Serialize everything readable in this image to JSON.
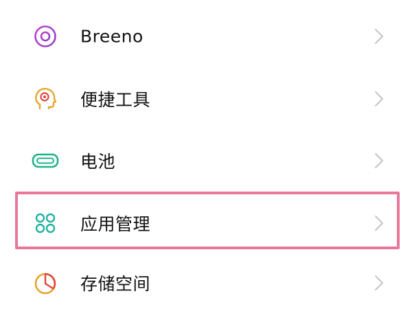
{
  "settings_list": {
    "items": [
      {
        "label": "Breeno",
        "icon": "breeno-icon",
        "icon_color": "#a23cc8"
      },
      {
        "label": "便捷工具",
        "icon": "convenience-tools-icon",
        "icon_color": "#e3a52b"
      },
      {
        "label": "电池",
        "icon": "battery-icon",
        "icon_color": "#1fb28a"
      },
      {
        "label": "应用管理",
        "icon": "app-management-icon",
        "icon_color": "#1fb2a0",
        "highlighted": true
      },
      {
        "label": "存储空间",
        "icon": "storage-icon",
        "icon_color": "#e3a52b"
      }
    ],
    "chevron_icon": "chevron-right-icon",
    "highlight_color": "#e8779a"
  }
}
